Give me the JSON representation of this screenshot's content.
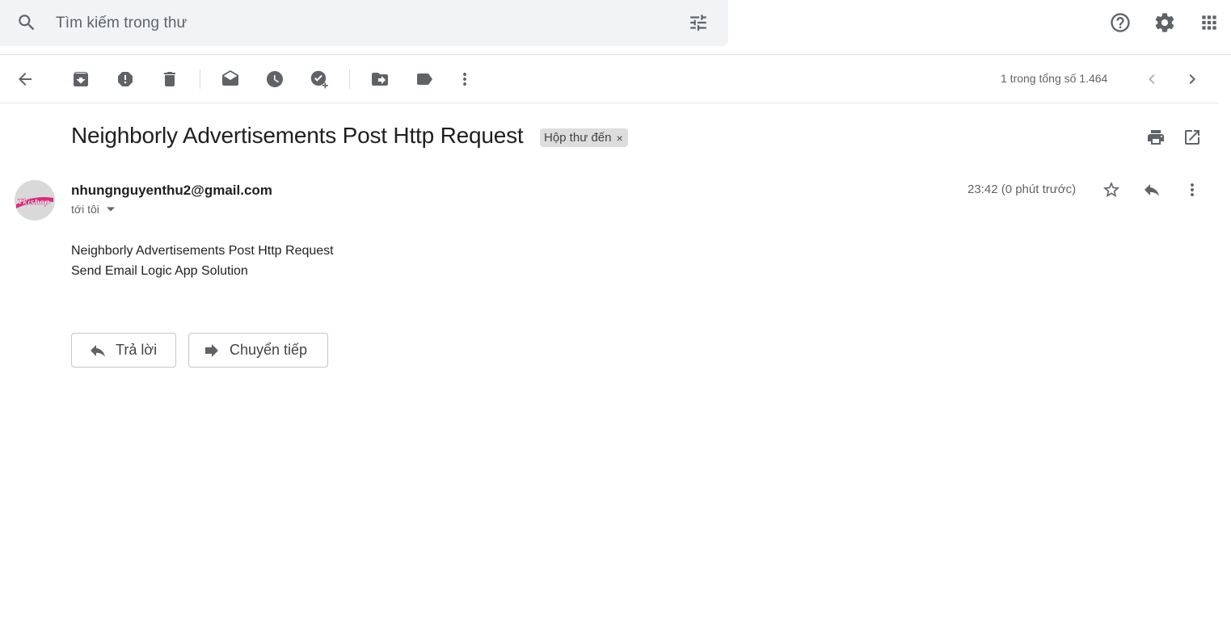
{
  "search": {
    "placeholder": "Tìm kiếm trong thư"
  },
  "toolbar": {
    "pager": "1 trong tổng số 1.464"
  },
  "email": {
    "subject": "Neighborly Advertisements Post Http Request",
    "label": "Hộp thư đến",
    "label_close": "×",
    "sender": "nhungnguyenthu2@gmail.com",
    "recipient": "tới tôi",
    "time": "23:42 (0 phút trước)",
    "body_lines": [
      "Neighborly Advertisements Post Http Request",
      "Send Email Logic App Solution"
    ],
    "avatar_text": "Tkishop"
  },
  "actions": {
    "reply": "Trả lời",
    "forward": "Chuyển tiếp"
  },
  "colors": {
    "icon": "#5f6368",
    "search_bg": "#f1f3f4",
    "chip_bg": "#dddddd",
    "avatar_accent": "#e0297a"
  }
}
